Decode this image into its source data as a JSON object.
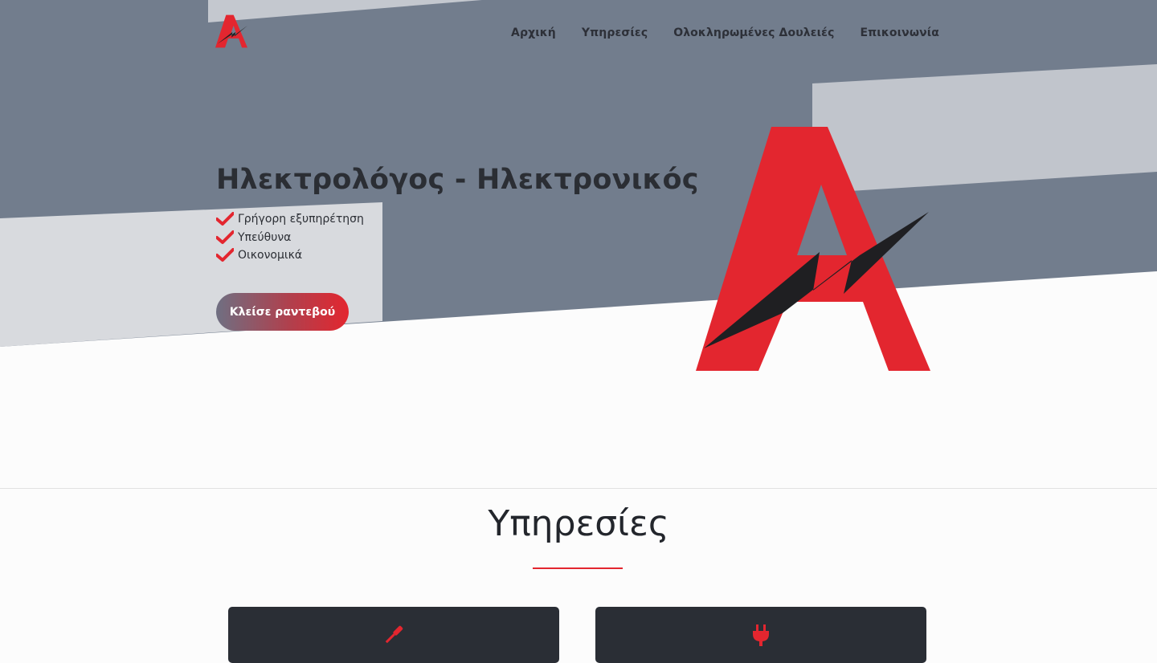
{
  "header": {
    "logo_alt": "A",
    "nav": [
      {
        "label": "Αρχική"
      },
      {
        "label": "Υπηρεσίες"
      },
      {
        "label": "Ολοκληρωμένες Δουλειές"
      },
      {
        "label": "Επικοινωνία"
      }
    ]
  },
  "hero": {
    "title": "Ηλεκτρολόγος - Ηλεκτρονικός",
    "features": [
      {
        "icon": "check-icon",
        "text": "Γρήγορη εξυπηρέτηση"
      },
      {
        "icon": "check-icon",
        "text": "Υπεύθυνα"
      },
      {
        "icon": "check-icon",
        "text": "Οικονομικά"
      }
    ],
    "cta_label": "Κλείσε ραντεβού"
  },
  "services": {
    "title": "Υπηρεσίες",
    "cards": [
      {
        "icon": "screwdriver-icon"
      },
      {
        "icon": "plug-icon"
      }
    ]
  },
  "colors": {
    "accent": "#e3262f",
    "hero_slate": "#727d8d",
    "card_dark": "#2a2e35"
  }
}
